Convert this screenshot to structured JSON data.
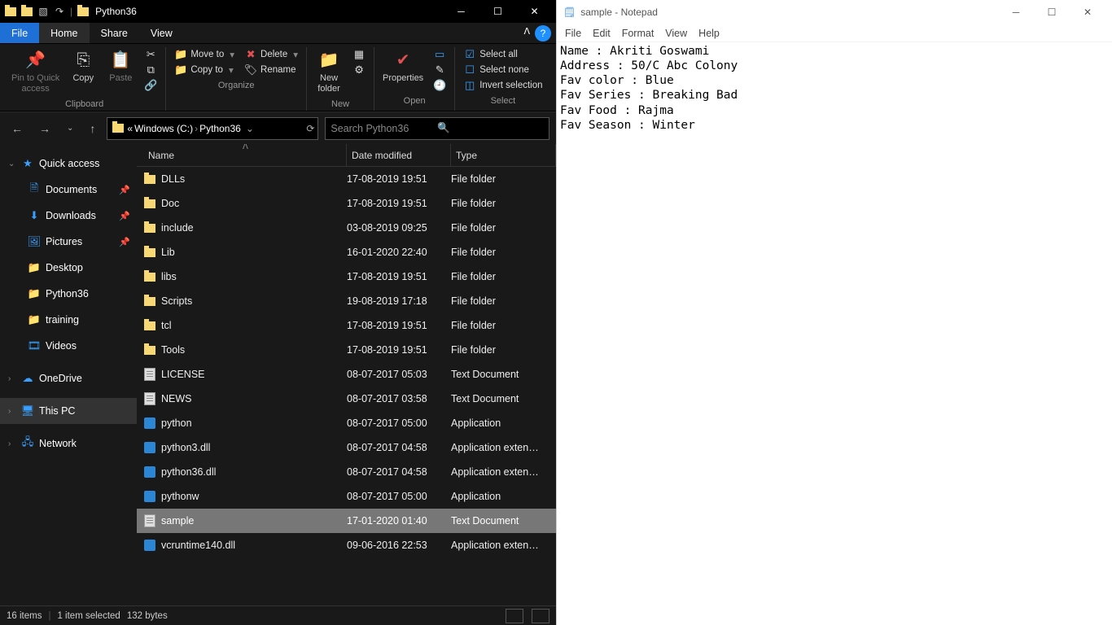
{
  "explorer": {
    "title": "Python36",
    "tabs": {
      "file": "File",
      "home": "Home",
      "share": "Share",
      "view": "View"
    },
    "ribbon": {
      "pin": "Pin to Quick\naccess",
      "copy": "Copy",
      "paste": "Paste",
      "clipboard_label": "Clipboard",
      "moveto": "Move to",
      "copyto": "Copy to",
      "delete": "Delete",
      "rename": "Rename",
      "organize_label": "Organize",
      "newfolder": "New\nfolder",
      "new_label": "New",
      "properties": "Properties",
      "open_label": "Open",
      "selectall": "Select all",
      "selectnone": "Select none",
      "invert": "Invert selection",
      "select_label": "Select"
    },
    "addr": {
      "root": "«",
      "drive": "Windows (C:)",
      "folder": "Python36"
    },
    "search_placeholder": "Search Python36",
    "tree": {
      "quick": "Quick access",
      "documents": "Documents",
      "downloads": "Downloads",
      "pictures": "Pictures",
      "desktop": "Desktop",
      "python36": "Python36",
      "training": "training",
      "videos": "Videos",
      "onedrive": "OneDrive",
      "thispc": "This PC",
      "network": "Network"
    },
    "columns": {
      "name": "Name",
      "date": "Date modified",
      "type": "Type"
    },
    "files": [
      {
        "name": "DLLs",
        "date": "17-08-2019 19:51",
        "type": "File folder",
        "icon": "folder",
        "sel": false
      },
      {
        "name": "Doc",
        "date": "17-08-2019 19:51",
        "type": "File folder",
        "icon": "folder",
        "sel": false
      },
      {
        "name": "include",
        "date": "03-08-2019 09:25",
        "type": "File folder",
        "icon": "folder",
        "sel": false
      },
      {
        "name": "Lib",
        "date": "16-01-2020 22:40",
        "type": "File folder",
        "icon": "folder",
        "sel": false
      },
      {
        "name": "libs",
        "date": "17-08-2019 19:51",
        "type": "File folder",
        "icon": "folder",
        "sel": false
      },
      {
        "name": "Scripts",
        "date": "19-08-2019 17:18",
        "type": "File folder",
        "icon": "folder",
        "sel": false
      },
      {
        "name": "tcl",
        "date": "17-08-2019 19:51",
        "type": "File folder",
        "icon": "folder",
        "sel": false
      },
      {
        "name": "Tools",
        "date": "17-08-2019 19:51",
        "type": "File folder",
        "icon": "folder",
        "sel": false
      },
      {
        "name": "LICENSE",
        "date": "08-07-2017 05:03",
        "type": "Text Document",
        "icon": "txt",
        "sel": false
      },
      {
        "name": "NEWS",
        "date": "08-07-2017 03:58",
        "type": "Text Document",
        "icon": "txt",
        "sel": false
      },
      {
        "name": "python",
        "date": "08-07-2017 05:00",
        "type": "Application",
        "icon": "app",
        "sel": false
      },
      {
        "name": "python3.dll",
        "date": "08-07-2017 04:58",
        "type": "Application exten…",
        "icon": "app",
        "sel": false
      },
      {
        "name": "python36.dll",
        "date": "08-07-2017 04:58",
        "type": "Application exten…",
        "icon": "app",
        "sel": false
      },
      {
        "name": "pythonw",
        "date": "08-07-2017 05:00",
        "type": "Application",
        "icon": "app",
        "sel": false
      },
      {
        "name": "sample",
        "date": "17-01-2020 01:40",
        "type": "Text Document",
        "icon": "txt",
        "sel": true
      },
      {
        "name": "vcruntime140.dll",
        "date": "09-06-2016 22:53",
        "type": "Application exten…",
        "icon": "app",
        "sel": false
      }
    ],
    "status": {
      "count": "16 items",
      "selected": "1 item selected",
      "size": "132 bytes"
    }
  },
  "notepad": {
    "title": "sample - Notepad",
    "menu": {
      "file": "File",
      "edit": "Edit",
      "format": "Format",
      "view": "View",
      "help": "Help"
    },
    "content": "Name : Akriti Goswami\nAddress : 50/C Abc Colony\nFav color : Blue\nFav Series : Breaking Bad\nFav Food : Rajma\nFav Season : Winter"
  }
}
